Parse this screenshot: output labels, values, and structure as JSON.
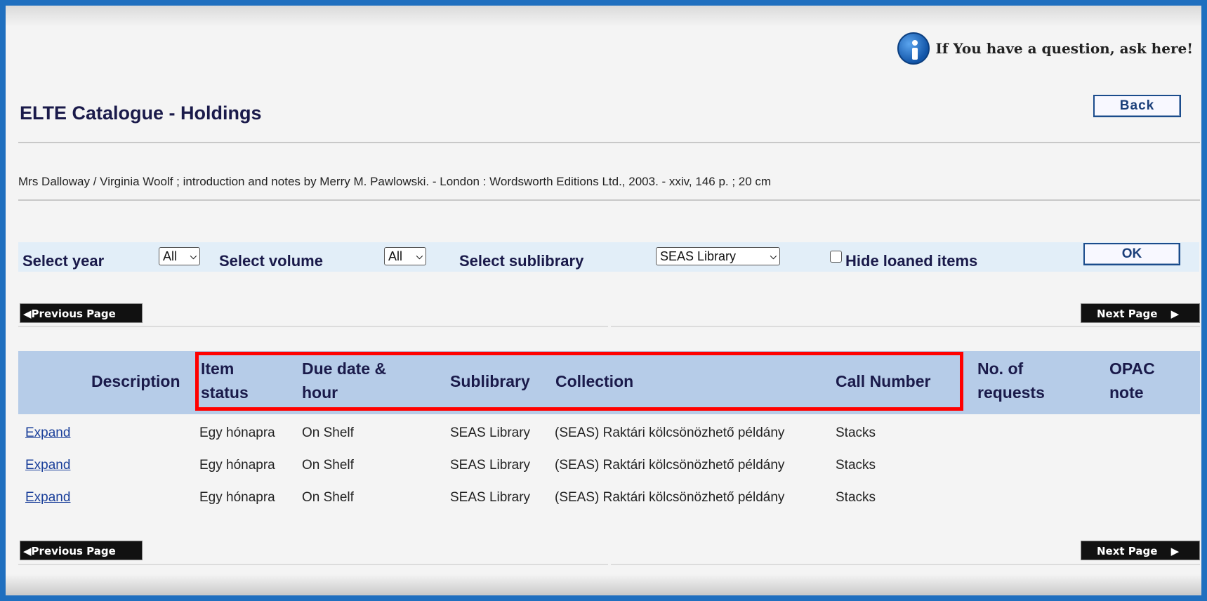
{
  "help": {
    "text": "If You have a question, ask here!"
  },
  "header": {
    "title": "ELTE Catalogue - Holdings",
    "back_label": "Back"
  },
  "citation": "Mrs Dalloway / Virginia Woolf ; introduction and notes by Merry M. Pawlowski. - London : Wordsworth Editions Ltd., 2003. - xxiv, 146 p. ; 20 cm",
  "filters": {
    "year_label": "Select year",
    "year_value": "All",
    "volume_label": "Select volume",
    "volume_value": "All",
    "sublibrary_label": "Select sublibrary",
    "sublibrary_value": "SEAS Library",
    "hide_loaned_label": "Hide loaned items",
    "hide_loaned_checked": false,
    "ok_label": "OK"
  },
  "pagination": {
    "prev_label": "Previous Page",
    "next_label": "Next Page"
  },
  "table": {
    "headers": {
      "description": "Description",
      "item_status_1": "Item",
      "item_status_2": "status",
      "due_1": "Due date &",
      "due_2": "hour",
      "sublibrary": "Sublibrary",
      "collection": "Collection",
      "call_number": "Call Number",
      "requests_1": "No. of",
      "requests_2": "requests",
      "opac_1": "OPAC",
      "opac_2": "note"
    },
    "rows": [
      {
        "description": "Expand",
        "item_status": "Egy hónapra",
        "due": "On Shelf",
        "sublibrary": "SEAS Library",
        "collection": "(SEAS) Raktári kölcsönözhető példány",
        "call_number": "Stacks",
        "requests": "",
        "opac_note": ""
      },
      {
        "description": "Expand",
        "item_status": "Egy hónapra",
        "due": "On Shelf",
        "sublibrary": "SEAS Library",
        "collection": "(SEAS) Raktári kölcsönözhető példány",
        "call_number": "Stacks",
        "requests": "",
        "opac_note": ""
      },
      {
        "description": "Expand",
        "item_status": "Egy hónapra",
        "due": "On Shelf",
        "sublibrary": "SEAS Library",
        "collection": "(SEAS) Raktári kölcsönözhető példány",
        "call_number": "Stacks",
        "requests": "",
        "opac_note": ""
      }
    ]
  },
  "colors": {
    "frame_border": "#1f6fbf",
    "header_bg": "#b6cce8",
    "filter_bg": "#e2eef8",
    "highlight": "#ff0000",
    "link": "#1a3f9a"
  }
}
